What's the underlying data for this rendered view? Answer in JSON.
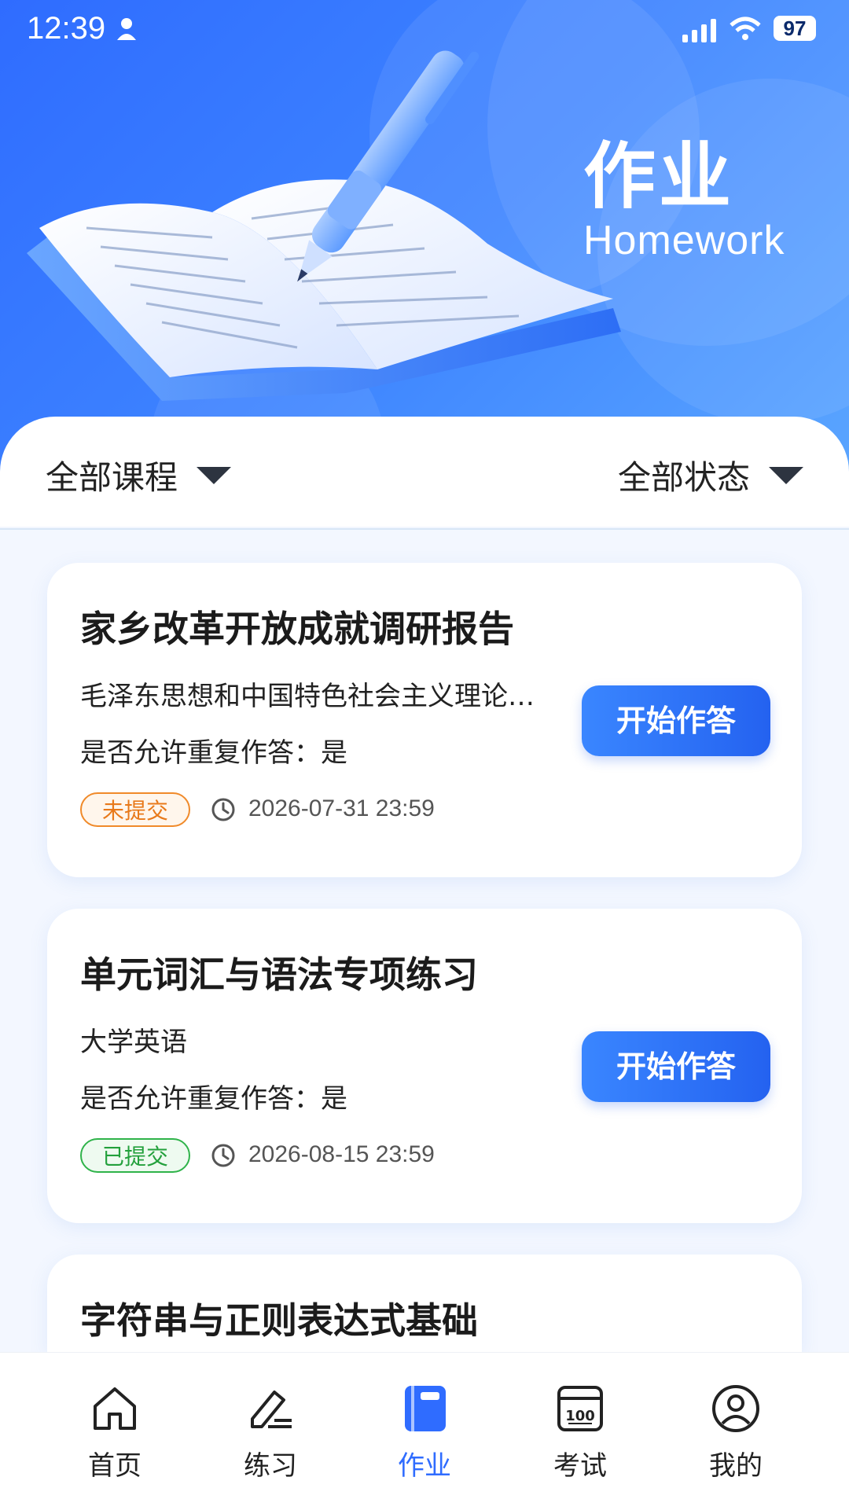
{
  "status_bar": {
    "time": "12:39",
    "battery": "97"
  },
  "hero": {
    "title": "作业",
    "subtitle": "Homework"
  },
  "filters": {
    "course": "全部课程",
    "status": "全部状态"
  },
  "assignments": [
    {
      "title": "家乡改革开放成就调研报告",
      "course": "毛泽东思想和中国特色社会主义理论体系概论",
      "repeat": "是否允许重复作答：是",
      "status": "未提交",
      "deadline": "2026-07-31 23:59",
      "button": "开始作答"
    },
    {
      "title": "单元词汇与语法专项练习",
      "course": "大学英语",
      "repeat": "是否允许重复作答：是",
      "status": "已提交",
      "deadline": "2026-08-15 23:59",
      "button": "开始作答"
    },
    {
      "title": "字符串与正则表达式基础"
    }
  ],
  "tabs": [
    {
      "label": "首页",
      "icon": "home-icon"
    },
    {
      "label": "练习",
      "icon": "practice-icon"
    },
    {
      "label": "作业",
      "icon": "homework-icon",
      "active": true
    },
    {
      "label": "考试",
      "icon": "exam-icon"
    },
    {
      "label": "我的",
      "icon": "profile-icon"
    }
  ],
  "colors": {
    "accent": "#2f6cff",
    "pending": "#e8791a",
    "submitted": "#23a03c"
  }
}
